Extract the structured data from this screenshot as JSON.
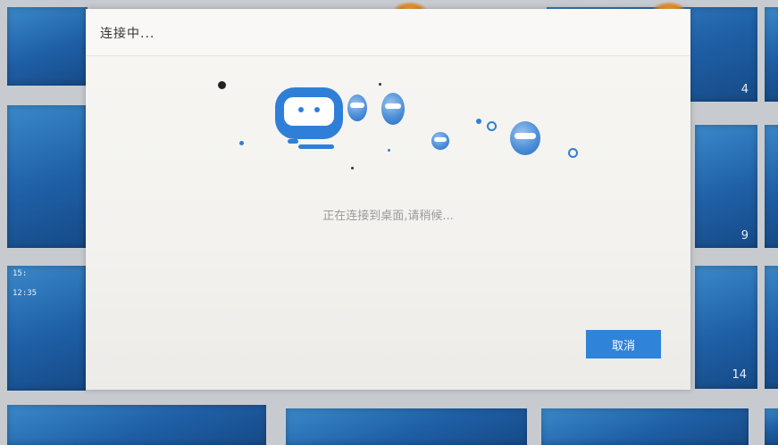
{
  "background": {
    "tile_numbers": [
      "4",
      "9",
      "14"
    ],
    "clock_lines": [
      "15:",
      "12:35"
    ]
  },
  "dialog": {
    "title": "连接中...",
    "status_text": "正在连接到桌面,请稍候...",
    "cancel_label": "取消"
  },
  "colors": {
    "accent": "#2f83d9",
    "mascot_blue": "#2f7fd8",
    "dialog_bg": "#f4f3f0",
    "status_text": "#9a9a9a"
  }
}
